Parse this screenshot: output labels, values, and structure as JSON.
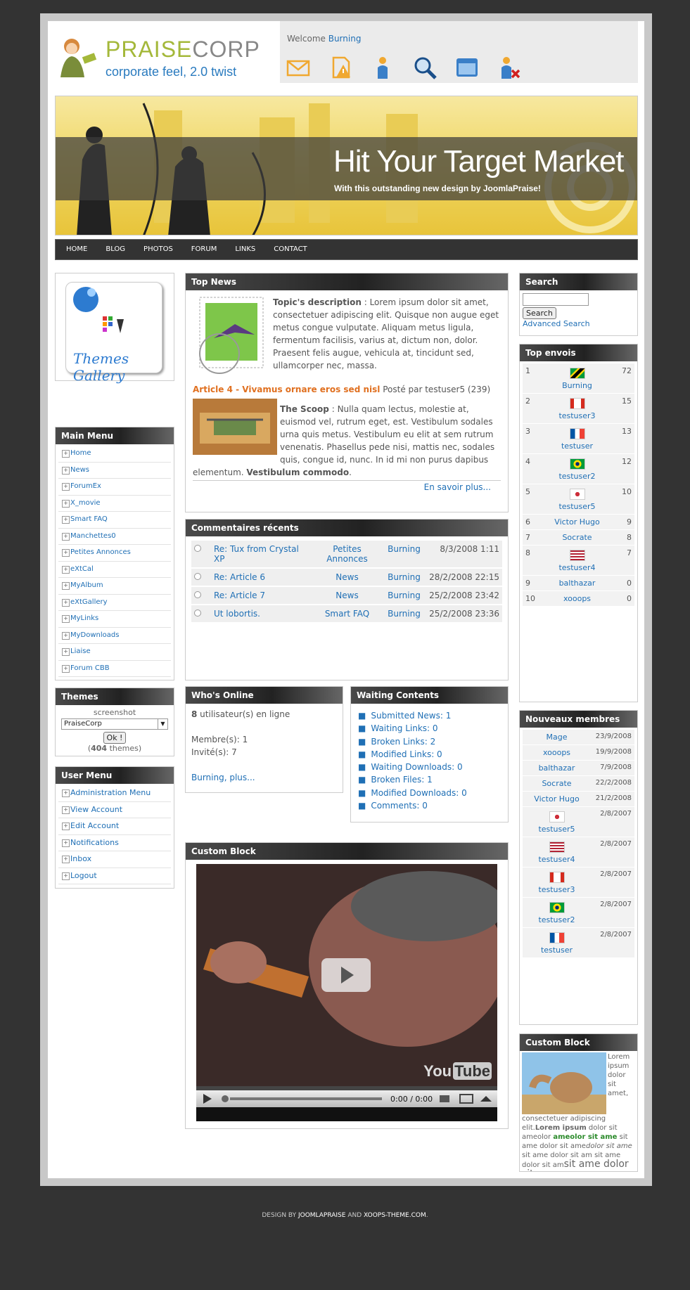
{
  "header": {
    "brand_left": "PRAISE",
    "brand_right": "CORP",
    "tagline": "corporate feel, 2.0 twist",
    "welcome": "Welcome",
    "username": "Burning"
  },
  "toolbar_icons": [
    "mail-icon",
    "alert-icon",
    "user-icon",
    "search-icon",
    "window-icon",
    "user-delete-icon"
  ],
  "banner": {
    "title": "Hit Your Target Market",
    "subtitle": "With this outstanding new design by JoomlaPraise!"
  },
  "nav": [
    "HOME",
    "BLOG",
    "PHOTOS",
    "FORUM",
    "LINKS",
    "CONTACT"
  ],
  "left": {
    "gallery_text": "Themes Gallery",
    "main_menu_title": "Main Menu",
    "main_menu": [
      "Home",
      "News",
      "ForumEx",
      "X_movie",
      "Smart FAQ",
      "Manchettes0",
      "Petites Annonces",
      "eXtCal",
      "MyAlbum",
      "eXtGallery",
      "MyLinks",
      "MyDownloads",
      "Liaise",
      "Forum CBB"
    ],
    "themes_title": "Themes",
    "themes_caption": "screenshot",
    "themes_selected": "PraiseCorp",
    "themes_ok": "Ok !",
    "themes_count_prefix": "(",
    "themes_count": "404",
    "themes_count_suffix": " themes)",
    "user_menu_title": "User Menu",
    "user_menu": [
      "Administration Menu",
      "View Account",
      "Edit Account",
      "Notifications",
      "Inbox",
      "Logout"
    ]
  },
  "center": {
    "top_news_title": "Top News",
    "topic_label": "Topic's description",
    "topic_text": " : Lorem ipsum dolor sit amet, consectetuer adipiscing elit. Quisque non augue eget metus congue vulputate. Aliquam metus ligula, fermentum facilisis, varius at, dictum non, dolor. Praesent felis augue, vehicula at, tincidunt sed, ullamcorper nec, massa.",
    "article_title": "Article 4 - Vivamus ornare eros sed nisl",
    "article_meta": " Posté par testuser5 (239)",
    "scoop_label": "The Scoop",
    "scoop_text": " : Nulla quam lectus, molestie at, euismod vel, rutrum eget, est. Vestibulum sodales urna quis metus. Vestibulum eu elit at sem rutrum venenatis. Phasellus pede nisi, mattis nec, sodales quis, congue id, nunc. In id mi non purus dapibus elementum. ",
    "scoop_bold": "Vestibulum commodo",
    "scoop_end": ".",
    "read_more": "En savoir plus...",
    "comments_title": "Commentaires récents",
    "comments": [
      {
        "title": "Re: Tux from Crystal XP",
        "module": "Petites Annonces",
        "user": "Burning",
        "date": "8/3/2008 1:11"
      },
      {
        "title": "Re: Article 6",
        "module": "News",
        "user": "Burning",
        "date": "28/2/2008 22:15"
      },
      {
        "title": "Re: Article 7",
        "module": "News",
        "user": "Burning",
        "date": "25/2/2008 23:42"
      },
      {
        "title": "Ut lobortis.",
        "module": "Smart FAQ",
        "user": "Burning",
        "date": "25/2/2008 23:36"
      }
    ],
    "online_title": "Who's Online",
    "online_count": "8",
    "online_text": " utilisateur(s) en ligne",
    "members": "Membre(s): 1",
    "guests": "Invité(s): 7",
    "online_link": "Burning, plus...",
    "waiting_title": "Waiting Contents",
    "waiting": [
      "Submitted News: 1",
      "Waiting Links: 0",
      "Broken Links: 2",
      "Modified Links: 0",
      "Waiting Downloads: 0",
      "Broken Files: 1",
      "Modified Downloads: 0",
      "Comments: 0"
    ],
    "custom_title": "Custom Block",
    "video_time": "0:00 / 0:00",
    "video_brand_a": "You",
    "video_brand_b": "Tube"
  },
  "right": {
    "search_title": "Search",
    "search_button": "Search",
    "advanced": "Advanced Search",
    "top_title": "Top envois",
    "top": [
      {
        "rank": "1",
        "name": "Burning",
        "count": "72",
        "flag": "jm"
      },
      {
        "rank": "2",
        "name": "testuser3",
        "count": "15",
        "flag": "ca"
      },
      {
        "rank": "3",
        "name": "testuser",
        "count": "13",
        "flag": "fr"
      },
      {
        "rank": "4",
        "name": "testuser2",
        "count": "12",
        "flag": "br"
      },
      {
        "rank": "5",
        "name": "testuser5",
        "count": "10",
        "flag": "kr"
      },
      {
        "rank": "6",
        "name": "Victor Hugo",
        "count": "9",
        "flag": ""
      },
      {
        "rank": "7",
        "name": "Socrate",
        "count": "8",
        "flag": ""
      },
      {
        "rank": "8",
        "name": "testuser4",
        "count": "7",
        "flag": "us"
      },
      {
        "rank": "9",
        "name": "balthazar",
        "count": "0",
        "flag": ""
      },
      {
        "rank": "10",
        "name": "xooops",
        "count": "0",
        "flag": ""
      }
    ],
    "new_title": "Nouveaux membres",
    "new": [
      {
        "name": "Mage",
        "date": "23/9/2008",
        "flag": ""
      },
      {
        "name": "xooops",
        "date": "19/9/2008",
        "flag": ""
      },
      {
        "name": "balthazar",
        "date": "7/9/2008",
        "flag": ""
      },
      {
        "name": "Socrate",
        "date": "22/2/2008",
        "flag": ""
      },
      {
        "name": "Victor Hugo",
        "date": "21/2/2008",
        "flag": ""
      },
      {
        "name": "testuser5",
        "date": "2/8/2007",
        "flag": "kr"
      },
      {
        "name": "testuser4",
        "date": "2/8/2007",
        "flag": "us"
      },
      {
        "name": "testuser3",
        "date": "2/8/2007",
        "flag": "ca"
      },
      {
        "name": "testuser2",
        "date": "2/8/2007",
        "flag": "br"
      },
      {
        "name": "testuser",
        "date": "2/8/2007",
        "flag": "fr"
      }
    ],
    "custom_title": "Custom Block",
    "lorem_side": "Lorem ipsum dolor sit amet,",
    "lorem_a": " consectetuer adipiscing elit.",
    "lorem_b": "Lorem ipsum",
    "lorem_c": " dolor sit ameolor ",
    "lorem_d": "ameolor sit ame",
    "lorem_e": " sit ame dolor sit ame",
    "lorem_f": "dolor sit ame",
    "lorem_g": " sit ame dolor sit am sit ame dolor sit am",
    "lorem_h": "sit ame dolor sit am"
  },
  "footer": {
    "design_by": "DESIGN BY ",
    "link1": "JOOMLAPRAISE",
    "and": " AND ",
    "link2": "XOOPS-THEME.COM",
    "dot": "."
  },
  "colors": {
    "accent": "#1f6fb5",
    "article": "#e07020",
    "header_dark": "#2b2b2b",
    "banner": "#f0d868"
  }
}
